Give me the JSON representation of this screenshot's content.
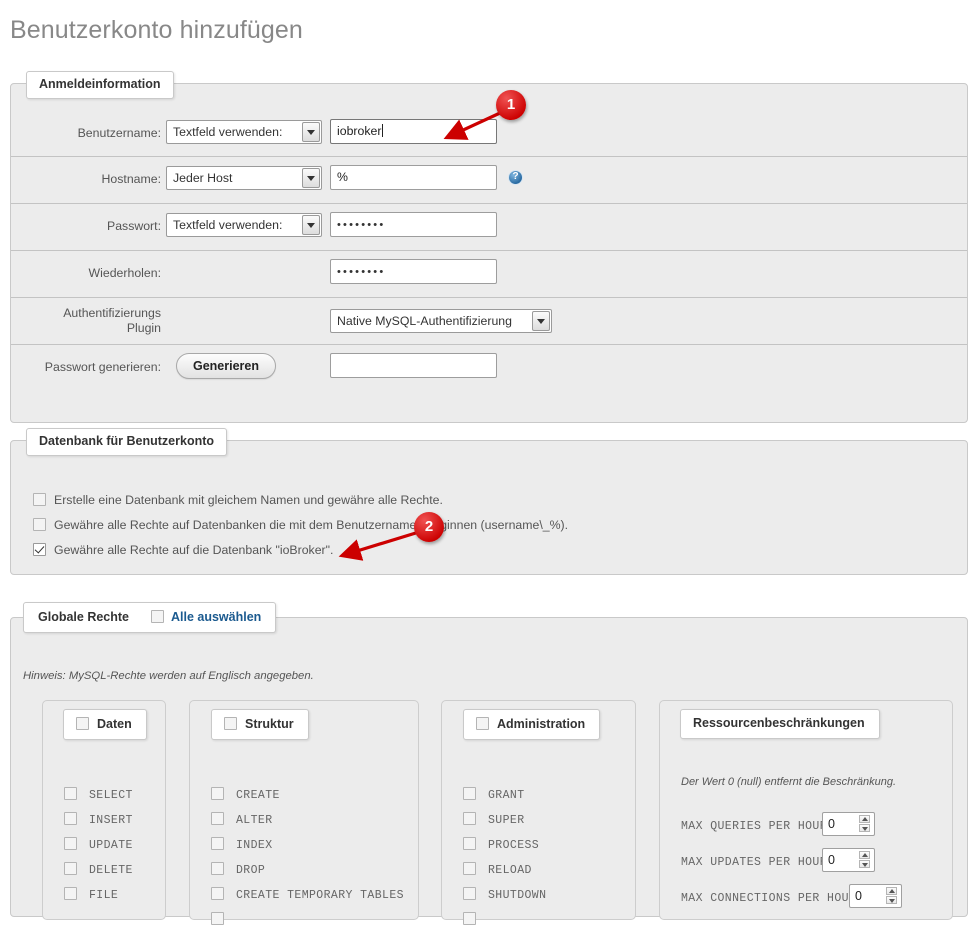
{
  "page": {
    "title": "Benutzerkonto hinzufügen"
  },
  "login": {
    "legend": "Anmeldeinformation",
    "rows": [
      {
        "label": "Benutzername:",
        "select_value": "Textfeld verwenden:",
        "input_value": "iobroker"
      },
      {
        "label": "Hostname:",
        "select_value": "Jeder Host",
        "input_value": "%",
        "help_icon": "help-icon"
      },
      {
        "label": "Passwort:",
        "select_value": "Textfeld verwenden:",
        "input_value": "••••••••"
      },
      {
        "label": "Wiederholen:",
        "input_value": "••••••••"
      },
      {
        "label_line1": "Authentifizierungs",
        "label_line2": "Plugin",
        "select_value": "Native MySQL-Authentifizierung"
      },
      {
        "label": "Passwort generieren:",
        "button_label": "Generieren",
        "input_value": ""
      }
    ]
  },
  "database": {
    "legend": "Datenbank für Benutzerkonto",
    "options": [
      {
        "label": "Erstelle eine Datenbank mit gleichem Namen und gewähre alle Rechte.",
        "checked": false
      },
      {
        "label": "Gewähre alle Rechte auf Datenbanken die mit dem Benutzernamen beginnen (username\\_%).",
        "checked": false
      },
      {
        "label": "Gewähre alle Rechte auf die Datenbank \"ioBroker\".",
        "checked": true
      }
    ]
  },
  "rights": {
    "legend": "Globale Rechte",
    "select_all_label": "Alle auswählen",
    "select_all_checked": false,
    "note": "Hinweis: MySQL-Rechte werden auf Englisch angegeben.",
    "columns": [
      {
        "legend": "Daten",
        "checked": false,
        "items": [
          "SELECT",
          "INSERT",
          "UPDATE",
          "DELETE",
          "FILE"
        ]
      },
      {
        "legend": "Struktur",
        "checked": false,
        "items": [
          "CREATE",
          "ALTER",
          "INDEX",
          "DROP",
          "CREATE TEMPORARY TABLES"
        ]
      },
      {
        "legend": "Administration",
        "checked": false,
        "items": [
          "GRANT",
          "SUPER",
          "PROCESS",
          "RELOAD",
          "SHUTDOWN"
        ]
      }
    ],
    "resources": {
      "legend": "Ressourcenbeschränkungen",
      "note": "Der Wert 0 (null) entfernt die Beschränkung.",
      "limits": [
        {
          "label": "MAX QUERIES PER HOUR",
          "value": "0"
        },
        {
          "label": "MAX UPDATES PER HOUR",
          "value": "0"
        },
        {
          "label": "MAX CONNECTIONS PER HOUR",
          "value": "0"
        }
      ]
    }
  },
  "annotations": {
    "marker_1": "1",
    "marker_2": "2",
    "color": "#cc0000"
  }
}
